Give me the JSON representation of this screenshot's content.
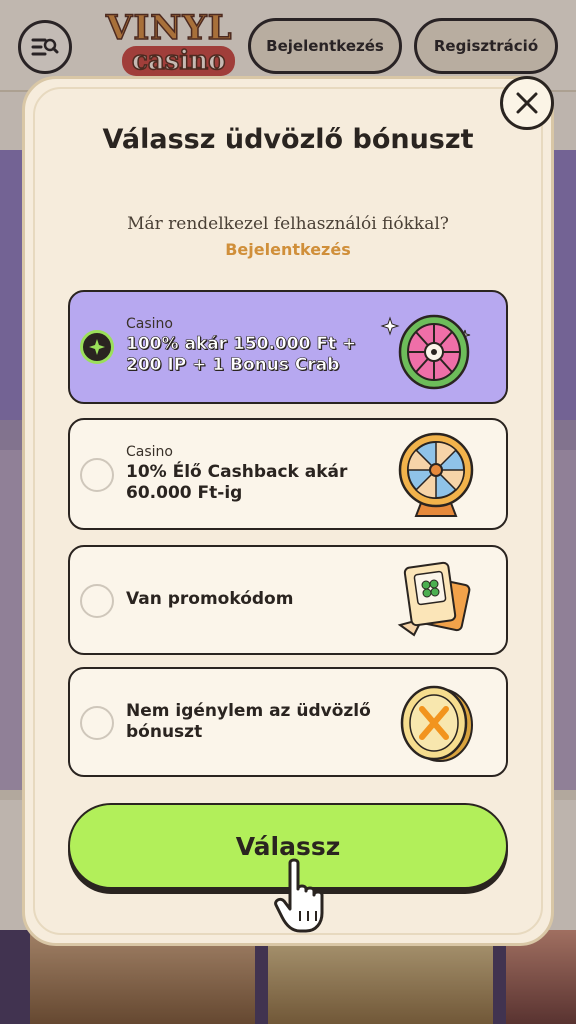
{
  "header": {
    "logo_text_1": "VINYL",
    "logo_text_2": "casino",
    "login_label": "Bejelentkezés",
    "register_label": "Regisztráció"
  },
  "modal": {
    "title": "Válassz üdvözlő bónuszt",
    "subtitle": "Már rendelkezel felhasználói fiókkal?",
    "login_link": "Bejelentkezés",
    "options": [
      {
        "category": "Casino",
        "text": "100% akár 150.000 Ft + 200 IP + 1 Bonus Crab",
        "selected": true,
        "icon": "roulette-wheel-icon"
      },
      {
        "category": "Casino",
        "text": "10% Élő Cashback akár 60.000 Ft-ig",
        "selected": false,
        "icon": "fortune-wheel-icon"
      },
      {
        "category": "",
        "text": "Van promokódom",
        "selected": false,
        "icon": "promo-ticket-icon"
      },
      {
        "category": "",
        "text": "Nem igénylem az üdvözlő bónuszt",
        "selected": false,
        "icon": "cancel-coin-icon"
      }
    ],
    "choose_label": "Válassz"
  },
  "colors": {
    "accent_green": "#b2ef5a",
    "selected_purple": "#b7a8f0",
    "link_orange": "#d08f3a",
    "modal_bg": "#f6ecdc"
  }
}
